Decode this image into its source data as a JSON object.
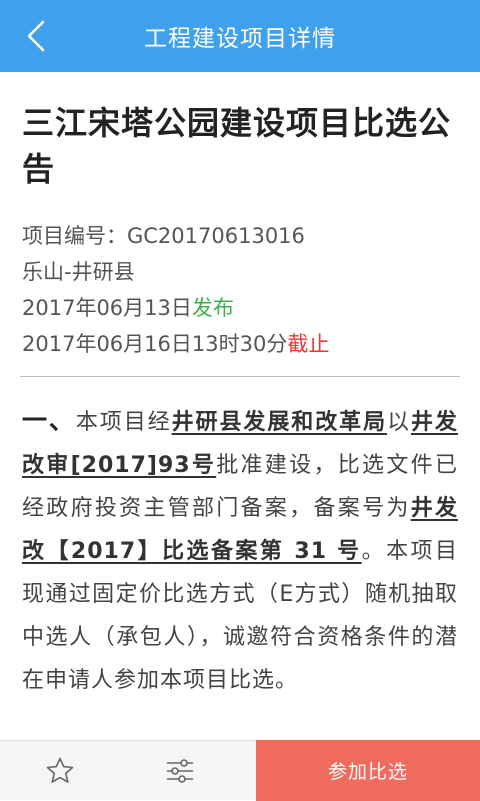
{
  "header": {
    "title": "工程建设项目详情",
    "back_icon": "chevron-left-icon"
  },
  "article": {
    "title": "三江宋塔公园建设项目比选公告",
    "project_no": "项目编号：GC20170613016",
    "region": "乐山-井研县",
    "publish_date": "2017年06月13日",
    "publish_label": "发布",
    "deadline_date": "2017年06月16日13时30分",
    "deadline_label": "截止",
    "body": {
      "lead": "一、",
      "t1": "本项目经",
      "u1": "井研县发展和改革局",
      "t2": "以",
      "u2": "井发改审[2017]93号",
      "t3": "批准建设，比选文件已经政府投资主管部门备案，备案号为",
      "u3": "井发改【2017】比选备案第 31 号",
      "t4": "。本项目现通过固定价比选方式（E方式）随机抽取中选人（承包人），诚邀符合资格条件的潜在申请人参加本项目比选。"
    }
  },
  "bottom": {
    "favorite_icon": "star-outline-icon",
    "filter_icon": "sliders-icon",
    "join_label": "参加比选"
  },
  "colors": {
    "header_bg": "#3fa0ec",
    "publish": "#3bb14a",
    "deadline": "#e53935",
    "join_button": "#ee6b5e"
  }
}
